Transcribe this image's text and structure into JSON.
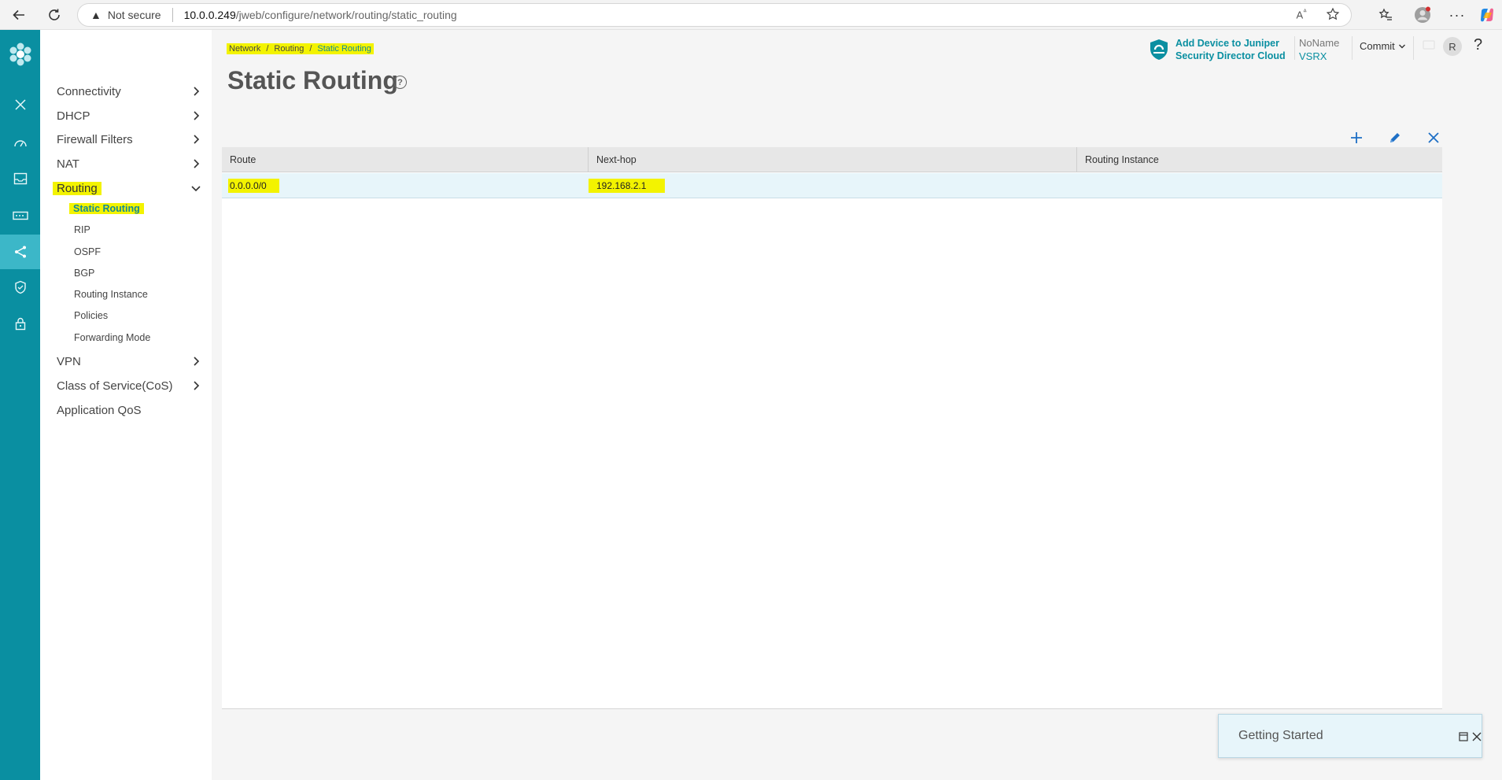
{
  "browser": {
    "not_secure": "Not secure",
    "url_host": "10.0.0.249",
    "url_path": "/jweb/configure/network/routing/static_routing"
  },
  "breadcrumb": {
    "items": [
      "Network",
      "Routing",
      "Static Routing"
    ],
    "separator": "/"
  },
  "page": {
    "title": "Static Routing"
  },
  "header": {
    "sd_cloud_line1": "Add Device to Juniper",
    "sd_cloud_line2": "Security Director Cloud",
    "device_name": "NoName",
    "device_model": "VSRX",
    "commit_label": "Commit",
    "avatar_initial": "R",
    "help_label": "?"
  },
  "subnav": {
    "items": [
      {
        "label": "Connectivity"
      },
      {
        "label": "DHCP"
      },
      {
        "label": "Firewall Filters"
      },
      {
        "label": "NAT"
      },
      {
        "label": "Routing"
      },
      {
        "label": "VPN"
      },
      {
        "label": "Class of Service(CoS)"
      },
      {
        "label": "Application QoS"
      }
    ],
    "routing_children": [
      "Static Routing",
      "RIP",
      "OSPF",
      "BGP",
      "Routing Instance",
      "Policies",
      "Forwarding Mode"
    ]
  },
  "table": {
    "columns": [
      "Route",
      "Next-hop",
      "Routing Instance"
    ],
    "rows": [
      {
        "route": "0.0.0.0/0",
        "next_hop": "192.168.2.1",
        "routing_instance": ""
      }
    ]
  },
  "getting_started": {
    "title": "Getting Started"
  },
  "colors": {
    "rail": "#0a8fa1",
    "rail_active": "#3cb7c8",
    "highlight": "#f3f300",
    "selected_row": "#e7f5fa"
  }
}
